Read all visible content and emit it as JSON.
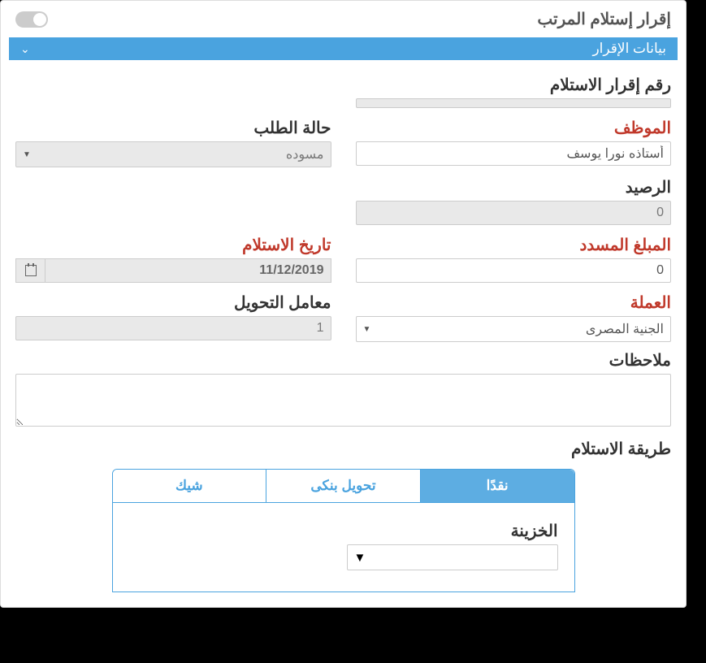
{
  "header": {
    "title": "إقرار إستلام المرتب"
  },
  "section": {
    "title": "بيانات الإقرار"
  },
  "labels": {
    "receipt_no": "رقم إقرار الاستلام",
    "employee": "الموظف",
    "status": "حالة الطلب",
    "balance": "الرصيد",
    "amount_paid": "المبلغ المسدد",
    "receive_date": "تاريخ الاستلام",
    "currency": "العملة",
    "exchange_rate": "معامل التحويل",
    "notes": "ملاحظات",
    "payment_method": "طريقة الاستلام",
    "treasury": "الخزينة"
  },
  "values": {
    "receipt_no": "",
    "employee": "أستاذه نورا يوسف",
    "status": "مسوده",
    "balance": "0",
    "amount_paid": "0",
    "receive_date": "11/12/2019",
    "currency": "الجنية المصرى",
    "exchange_rate": "1",
    "notes": "",
    "treasury": ""
  },
  "tabs": {
    "cash": "نقدًا",
    "bank": "تحويل بنكى",
    "cheque": "شيك"
  }
}
